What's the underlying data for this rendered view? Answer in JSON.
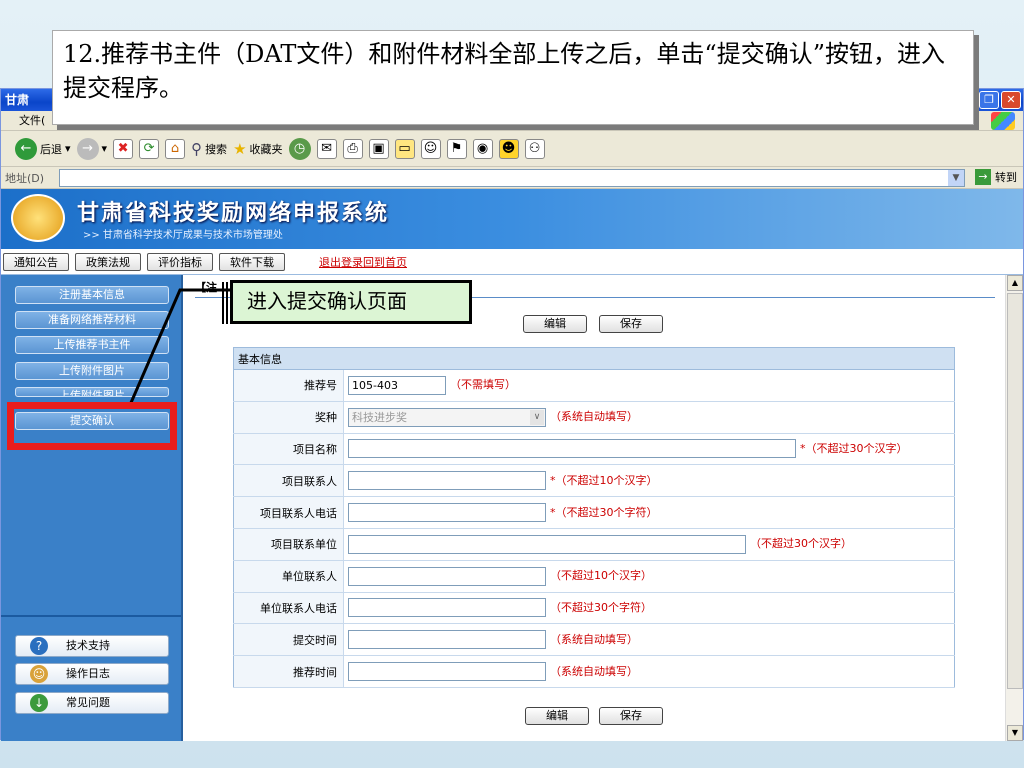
{
  "caption": "12.推荐书主件（DAT文件）和附件材料全部上传之后，单击“提交确认”按钮，进入提交程序。",
  "window": {
    "title": "甘肃",
    "menu": "文件(",
    "toolbar": {
      "back": "后退",
      "search": "搜索",
      "favorites": "收藏夹"
    },
    "address_label": "地址(D)",
    "go_label": "转到"
  },
  "banner": {
    "title": "甘肃省科技奖励网络申报系统",
    "subtitle": ">> 甘肃省科学技术厅成果与技术市场管理处"
  },
  "nav": {
    "items": [
      "通知公告",
      "政策法规",
      "评价指标",
      "软件下载"
    ],
    "logout": "退出登录回到首页"
  },
  "sidebar": {
    "items": [
      "注册基本信息",
      "准备网络推荐材料",
      "上传推荐书主件",
      "上传附件图片",
      "上传附件图片",
      "提交确认"
    ],
    "bottom": [
      "技术支持",
      "操作日志",
      "常见问题"
    ]
  },
  "callout": "进入提交确认页面",
  "main": {
    "tab": "【注",
    "edit_label": "编辑",
    "save_label": "保存",
    "section": "基本信息",
    "fields": [
      {
        "label": "推荐号",
        "value": "105-403",
        "hint": "（不需填写）"
      },
      {
        "label": "奖种",
        "value": "科技进步奖",
        "hint": "（系统自动填写）"
      },
      {
        "label": "项目名称",
        "value": "",
        "hint": "*（不超过30个汉字）"
      },
      {
        "label": "项目联系人",
        "value": "",
        "hint": "*（不超过10个汉字）"
      },
      {
        "label": "项目联系人电话",
        "value": "",
        "hint": "*（不超过30个字符）"
      },
      {
        "label": "项目联系单位",
        "value": "",
        "hint": "（不超过30个汉字）"
      },
      {
        "label": "单位联系人",
        "value": "",
        "hint": "（不超过10个汉字）"
      },
      {
        "label": "单位联系人电话",
        "value": "",
        "hint": "（不超过30个字符）"
      },
      {
        "label": "提交时间",
        "value": "",
        "hint": "（系统自动填写）"
      },
      {
        "label": "推荐时间",
        "value": "",
        "hint": "（系统自动填写）"
      }
    ]
  },
  "colors": {
    "accent": "#3a80c8",
    "hint": "#cc0000",
    "highlight": "#ea1c1c",
    "callout_bg": "#dcf5d4"
  }
}
